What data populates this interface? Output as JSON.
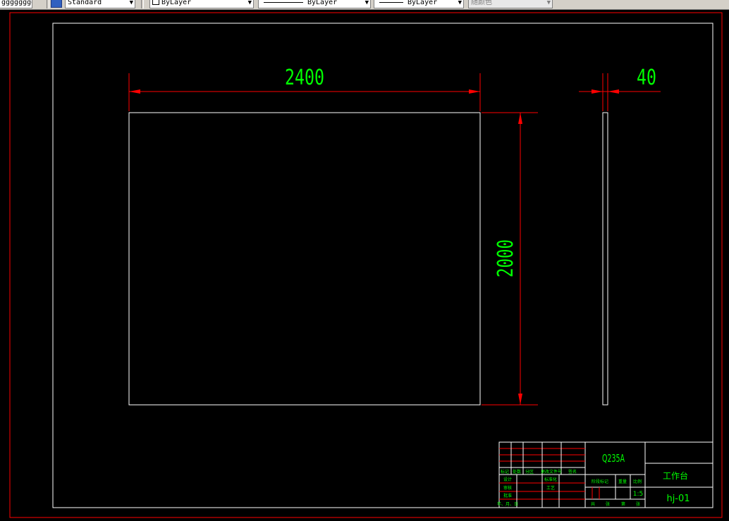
{
  "toolbar": {
    "layer_state": "ggggggggggg",
    "text_style": "Standard",
    "color_control": "ByLayer",
    "linetype_control": "ByLayer",
    "lineweight_control": "ByLayer",
    "plot_style": "随颜色"
  },
  "drawing": {
    "dim_width": "2400",
    "dim_height": "2000",
    "dim_thickness": "40"
  },
  "title_block": {
    "material": "Q235A",
    "part_name": "工作台",
    "drawing_number": "hj-01",
    "scale": "1:5",
    "row_labels": [
      "标记",
      "处数",
      "分区",
      "更改文件号",
      "签名",
      "年、月、日"
    ],
    "sign_labels": [
      "设计",
      "标准化",
      "审核",
      "工艺",
      "批准"
    ],
    "stage_label": "阶段标记",
    "weight_label": "重量",
    "scale_label": "比例",
    "sheet_labels": [
      "共",
      "张",
      "第",
      "张"
    ]
  },
  "colors": {
    "background": "#000000",
    "object_lines": "#ffffff",
    "dimension_lines": "#ff0000",
    "dimension_text": "#00ff00"
  }
}
